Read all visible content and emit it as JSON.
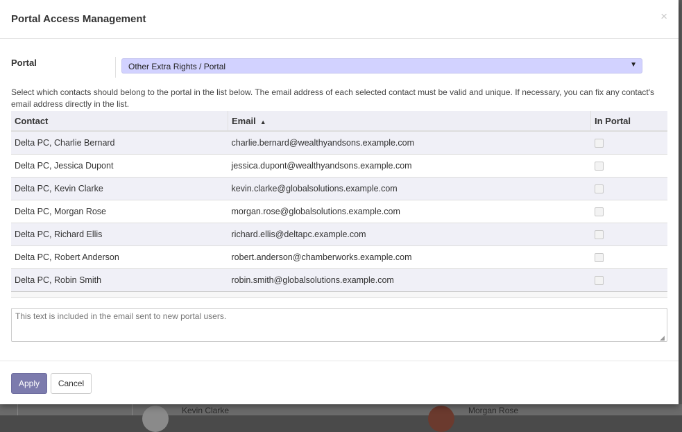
{
  "modal": {
    "title": "Portal Access Management",
    "close_icon": "×"
  },
  "portal_field": {
    "label": "Portal",
    "selected": "Other Extra Rights / Portal",
    "caret": "▼"
  },
  "help_text": "Select which contacts should belong to the portal in the list below. The email address of each selected contact must be valid and unique. If necessary, you can fix any contact's email address directly in the list.",
  "table": {
    "columns": [
      "Contact",
      "Email",
      "In Portal"
    ],
    "sort_icon": "▲",
    "rows": [
      {
        "contact": "Delta PC, Charlie Bernard",
        "email": "charlie.bernard@wealthyandsons.example.com",
        "in_portal": false
      },
      {
        "contact": "Delta PC, Jessica Dupont",
        "email": "jessica.dupont@wealthyandsons.example.com",
        "in_portal": false
      },
      {
        "contact": "Delta PC, Kevin Clarke",
        "email": "kevin.clarke@globalsolutions.example.com",
        "in_portal": false
      },
      {
        "contact": "Delta PC, Morgan Rose",
        "email": "morgan.rose@globalsolutions.example.com",
        "in_portal": false
      },
      {
        "contact": "Delta PC, Richard Ellis",
        "email": "richard.ellis@deltapc.example.com",
        "in_portal": false
      },
      {
        "contact": "Delta PC, Robert Anderson",
        "email": "robert.anderson@chamberworks.example.com",
        "in_portal": false
      },
      {
        "contact": "Delta PC, Robin Smith",
        "email": "robin.smith@globalsolutions.example.com",
        "in_portal": false
      }
    ]
  },
  "welcome_message": {
    "placeholder": "This text is included in the email sent to new portal users.",
    "value": ""
  },
  "footer": {
    "apply_label": "Apply",
    "cancel_label": "Cancel"
  },
  "background": {
    "names": [
      "Kevin Clarke",
      "Morgan Rose"
    ]
  },
  "colors": {
    "select_bg": "#d2d2ff",
    "primary_button": "#7c7bad"
  }
}
